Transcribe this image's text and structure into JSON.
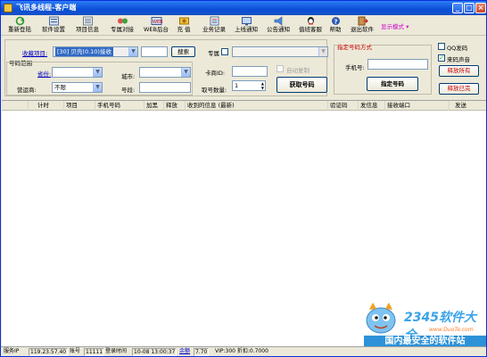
{
  "window": {
    "title": "飞讯多线程-客户端",
    "min": "_",
    "max": "□",
    "close": "×"
  },
  "toolbar": {
    "items": [
      {
        "label": "重新登陆",
        "icon": "refresh-icon"
      },
      {
        "label": "软件设置",
        "icon": "settings-icon"
      },
      {
        "label": "项目信息",
        "icon": "project-info-icon"
      },
      {
        "label": "专属对接",
        "icon": "dock-icon"
      },
      {
        "label": "WEB后台",
        "icon": "web-icon"
      },
      {
        "label": "充 值",
        "icon": "recharge-icon"
      },
      {
        "label": "业务记录",
        "icon": "record-icon"
      },
      {
        "label": "上线通知",
        "icon": "online-notify-icon"
      },
      {
        "label": "公告通知",
        "icon": "announcement-icon"
      },
      {
        "label": "值班客服",
        "icon": "qq-service-icon"
      },
      {
        "label": "帮助",
        "icon": "help-icon"
      },
      {
        "label": "退出软件",
        "icon": "exit-icon"
      }
    ],
    "mode": "显示模式 ▾"
  },
  "form": {
    "project_label": "收藏项目:",
    "project_value": "[30]   贝壳(0.10)接收",
    "search_button": "搜索",
    "exclusive_label": "专属",
    "number_range_label": "号码范围",
    "province_label": "省份:",
    "city_label": "城市:",
    "card_merchant_label": "卡商ID:",
    "auto_copy_label": "自动复制",
    "operator_label": "营运商:",
    "operator_value": "不限",
    "segment_label": "号段:",
    "count_label": "取号数量:",
    "count_value": "1",
    "get_number_button": "获取号码",
    "specify_group_label": "指定号码方式",
    "phone_label": "手机号:",
    "specify_button": "指定号码",
    "qq_send_label": "QQ发码",
    "sound_label": "来码声音",
    "release_all_button": "释放所有",
    "release_done_button": "释放已完"
  },
  "grid": {
    "columns": [
      "计时",
      "项目",
      "手机号码",
      "加黑",
      "释放",
      "收到的信息 (最新)",
      "验证码",
      "发信息",
      "接收端口",
      "发送"
    ]
  },
  "watermark": {
    "site": "2345软件大全",
    "url": "www.DuoTe.com",
    "banner": "国内最安全的软件站"
  },
  "status": {
    "ip_label": "服务IP",
    "ip_value": "119.23.57.40",
    "account_label": "账号",
    "account_value": "11111",
    "login_label": "登录时间",
    "login_value": "10-08 13:00:37",
    "balance_label": "余额",
    "balance_value": "7.70",
    "vip_value": "VIP:300 折扣:0.7000"
  },
  "colors": {
    "titlebar": "#0a4fd6",
    "accent_link": "#0000c0",
    "group_title": "#c00000",
    "mode_text": "#d000d0",
    "watermark": "#2d92d8"
  }
}
